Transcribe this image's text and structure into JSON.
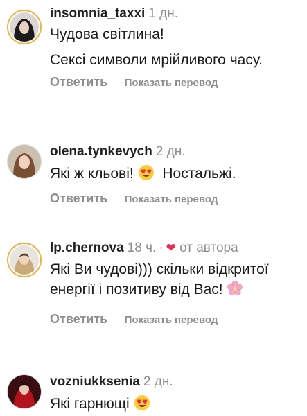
{
  "comments": [
    {
      "username": "insomnia_taxxi",
      "time": "1 дн.",
      "paragraphs": [
        "Чудова світлина!",
        "Сексі символи мрійливого часу."
      ],
      "reply": "Ответить",
      "translate": "Показать перевод"
    },
    {
      "username": "olena.tynkevych",
      "time": "2 дн.",
      "text_before": "Які ж кльові!",
      "emoji": "heart-eyes-emoji",
      "text_after": "Ностальжі.",
      "reply": "Ответить",
      "translate": "Показать перевод"
    },
    {
      "username": "lp.chernova",
      "time": "18 ч.",
      "separator": "·",
      "author_badge": "от автора",
      "text_before": "Які Ви чудові))) скільки відкритої енергії і позитиву від Вас!",
      "emoji": "cherry-blossom-emoji",
      "reply": "Ответить",
      "translate": "Показать перевод"
    },
    {
      "username": "vozniukksenia",
      "time": "2 дн.",
      "text_before": "Які гарнющі",
      "emoji": "heart-eyes-emoji"
    }
  ],
  "colors": {
    "muted": "#8e8e8e",
    "heart": "#ed2b52",
    "story_ring": "#f2b03c"
  }
}
